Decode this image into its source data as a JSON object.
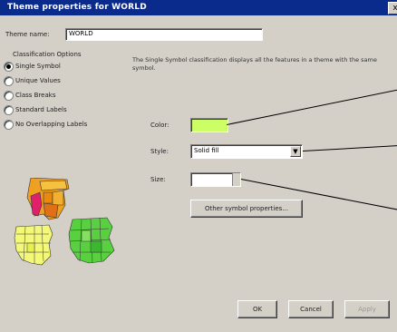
{
  "window": {
    "title": "Theme properties for WORLD",
    "close_label": "x"
  },
  "theme_name": {
    "label": "Theme name:",
    "value": "WORLD"
  },
  "classification": {
    "heading": "Classification Options",
    "options": [
      {
        "label": "Single Symbol",
        "selected": true
      },
      {
        "label": "Unique Values",
        "selected": false
      },
      {
        "label": "Class Breaks",
        "selected": false
      },
      {
        "label": "Standard Labels",
        "selected": false
      },
      {
        "label": "No Overlapping Labels",
        "selected": false
      }
    ]
  },
  "description": "The Single Symbol classification displays all the features in a theme with the same symbol.",
  "symbol": {
    "color_label": "Color:",
    "color_value": "#ccff66",
    "style_label": "Style:",
    "style_value": "Solid fill",
    "size_label": "Size:",
    "size_value": "",
    "other_button": "Other symbol properties..."
  },
  "buttons": {
    "ok": "OK",
    "cancel": "Cancel",
    "apply": "Apply"
  },
  "icons": {
    "close": "close-icon",
    "dropdown": "chevron-down-icon",
    "preview": "map-preview-icon"
  }
}
